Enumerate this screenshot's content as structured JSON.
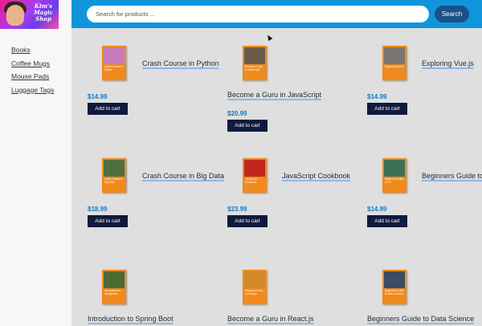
{
  "logo": {
    "text": "Kim's Magic Shop"
  },
  "sidebar": {
    "categories": [
      {
        "label": "Books"
      },
      {
        "label": "Coffee Mugs"
      },
      {
        "label": "Mouse Pads"
      },
      {
        "label": "Luggage Tags"
      }
    ]
  },
  "search": {
    "placeholder": "Search for products ...",
    "button_label": "Search"
  },
  "products": [
    {
      "title": "Crash Course in Python",
      "price": "$14.99",
      "cover_text": "Crash Course in Python",
      "button": "Add to cart",
      "cover_color": "#c77bb8"
    },
    {
      "title": "Become a Guru in JavaScript",
      "price": "$20.99",
      "cover_text": "Become a Guru in JavaScript",
      "button": "Add to cart",
      "cover_color": "#6b5a48"
    },
    {
      "title": "Exploring Vue.js",
      "price": "$14.99",
      "cover_text": "Exploring Vue.js",
      "button": "Add to cart",
      "cover_color": "#7a7670"
    },
    {
      "title": "Crash Course in Big Data",
      "price": "$18.99",
      "cover_text": "Crash Course in Big Data",
      "button": "Add to cart",
      "cover_color": "#4f6f3f"
    },
    {
      "title": "JavaScript Cookbook",
      "price": "$23.99",
      "cover_text": "JavaScript Cookbook",
      "button": "Add to cart",
      "cover_color": "#c0261b"
    },
    {
      "title": "Beginners Guide to Go",
      "price": "$14.99",
      "cover_text": "Beginners Guide to Go",
      "button": "Add to cart",
      "cover_color": "#3f6f53"
    },
    {
      "title": "Introduction to Spring Boot",
      "cover_text": "Introduction to Spring Boot",
      "cover_color": "#4d6a33"
    },
    {
      "title": "Become a Guru in React.js",
      "cover_text": "Become a Guru in React.js",
      "cover_color": "#d48a2a"
    },
    {
      "title": "Beginners Guide to Data Science",
      "cover_text": "Beginners Guide to Data Science",
      "cover_color": "#3a4d63"
    }
  ]
}
